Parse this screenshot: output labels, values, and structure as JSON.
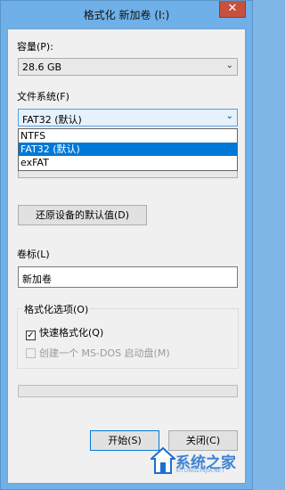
{
  "window": {
    "title": "格式化 新加卷 (I:)",
    "close_glyph": "✕"
  },
  "capacity": {
    "label": "容量(P):",
    "value": "28.6 GB"
  },
  "filesystem": {
    "label": "文件系统(F)",
    "value": "FAT32 (默认)",
    "options": [
      "NTFS",
      "FAT32 (默认)",
      "exFAT"
    ],
    "selected_index": 1
  },
  "restore_defaults_label": "还原设备的默认值(D)",
  "volume_label": {
    "label": "卷标(L)",
    "value": "新加卷"
  },
  "format_options": {
    "title": "格式化选项(O)",
    "quick_format": {
      "label": "快速格式化(Q)",
      "checked": true
    },
    "msdos_boot": {
      "label": "创建一个 MS-DOS 启动盘(M)",
      "checked": false,
      "enabled": false
    }
  },
  "progress": {
    "fraction": 0
  },
  "buttons": {
    "start": "开始(S)",
    "close": "关闭(C)"
  },
  "watermark": {
    "text": "系统之家",
    "sub": "XITONGZHIJIA.NET"
  },
  "colors": {
    "accent": "#0078d7",
    "title_bar": "#6fb0e8",
    "close_button": "#c7503f"
  }
}
